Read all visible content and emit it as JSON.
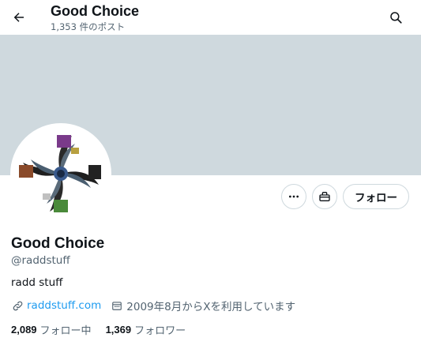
{
  "header": {
    "title": "Good Choice",
    "post_count": "1,353 件のポスト"
  },
  "icons": {
    "back": "arrow-left-icon",
    "search": "search-icon",
    "more": "more-horizontal-icon",
    "gift": "gift-icon",
    "link": "link-icon",
    "calendar": "calendar-icon"
  },
  "profile": {
    "display_name": "Good Choice",
    "handle": "@raddstuff",
    "bio": "radd stuff",
    "website": "raddstuff.com",
    "joined": "2009年8月からXを利用しています",
    "following_count": "2,089",
    "following_label": "フォロー中",
    "followers_count": "1,369",
    "followers_label": "フォロワー"
  },
  "buttons": {
    "follow_label": "フォロー"
  },
  "colors": {
    "banner": "#cfd9de",
    "link": "#1d9bf0",
    "secondary_text": "#536471",
    "primary_text": "#0f1419"
  }
}
